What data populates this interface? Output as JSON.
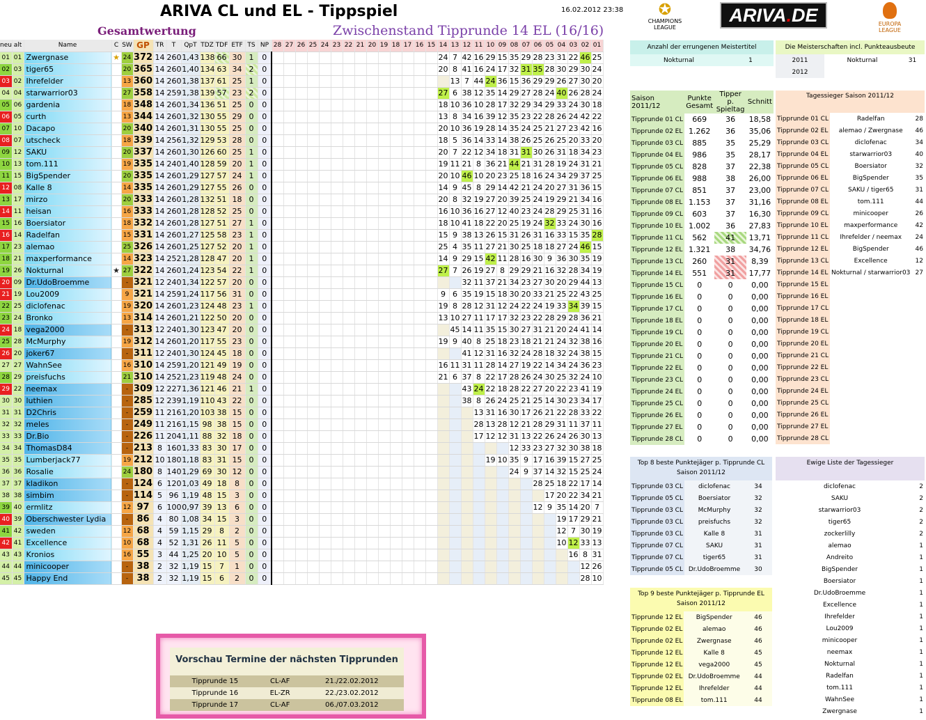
{
  "title": "ARIVA CL und EL - Tippspiel",
  "date": "16.02.2012 23:38",
  "logo_cl": "CHAMPIONS LEAGUE",
  "logo_ariva": "ARIVA.DE",
  "logo_el": "EUROPA LEAGUE",
  "gesamt": "Gesamtwertung",
  "zwischen": "Zwischenstand Tipprunde 14 EL (16/16)",
  "cols": [
    "neu",
    "alt",
    "Name",
    "C",
    "SW",
    "GP",
    "TR",
    "T",
    "QpT",
    "TDZ",
    "TDF",
    "ETF",
    "TS",
    "NP"
  ],
  "round_cols": [
    "28",
    "27",
    "26",
    "25",
    "24",
    "23",
    "22",
    "21",
    "20",
    "19",
    "18",
    "17",
    "16",
    "15",
    "14",
    "13",
    "12",
    "11",
    "10",
    "09",
    "08",
    "07",
    "06",
    "05",
    "04",
    "03",
    "02",
    "01"
  ],
  "rows": [
    [
      "01",
      "01",
      "Zwergnase",
      "★",
      "24",
      "372",
      "14",
      "260",
      "1,43",
      "138",
      "66",
      "30",
      "1",
      "0",
      "24 7 42 16 29 15 35 29 28 23 31 22 46 25"
    ],
    [
      "02",
      "03",
      "tiger65",
      "",
      "20",
      "365",
      "14",
      "260",
      "1,40",
      "134",
      "63",
      "34",
      "2",
      "0",
      "20 8 41 16 24 17 32 31 35 28 30 29 30 24"
    ],
    [
      "03",
      "02",
      "Ihrefelder",
      "",
      "13",
      "360",
      "14",
      "260",
      "1,38",
      "137",
      "61",
      "25",
      "1",
      "0",
      "13 7 44 24 36 15 36 29 29 26 27 30 20"
    ],
    [
      "04",
      "04",
      "starwarrior03",
      "",
      "27",
      "358",
      "14",
      "259",
      "1,38",
      "139",
      "57",
      "23",
      "2",
      "0",
      "27 6 38 12 35 14 29 27 28 24 40 26 28 24"
    ],
    [
      "05",
      "06",
      "gardenia",
      "",
      "18",
      "348",
      "14",
      "260",
      "1,34",
      "136",
      "51",
      "25",
      "0",
      "0",
      "18 10 36 10 28 17 32 29 34 29 33 24 30 18"
    ],
    [
      "06",
      "05",
      "curth",
      "",
      "13",
      "344",
      "14",
      "260",
      "1,32",
      "130",
      "55",
      "29",
      "0",
      "0",
      "13 8 34 16 39 12 35 23 22 28 26 24 42 22"
    ],
    [
      "07",
      "10",
      "Dacapo",
      "",
      "20",
      "340",
      "14",
      "260",
      "1,31",
      "130",
      "55",
      "25",
      "0",
      "0",
      "20 10 36 19 28 14 35 24 25 21 27 23 42 16"
    ],
    [
      "08",
      "07",
      "utscheck",
      "",
      "18",
      "339",
      "14",
      "256",
      "1,32",
      "129",
      "53",
      "28",
      "0",
      "0",
      "18 5 36 14 33 14 38 26 25 26 25 20 33 20"
    ],
    [
      "09",
      "12",
      "SAKU",
      "",
      "20",
      "337",
      "14",
      "260",
      "1,30",
      "126",
      "60",
      "25",
      "1",
      "0",
      "20 7 22 12 34 18 31 31 30 26 31 18 34 23"
    ],
    [
      "10",
      "13",
      "tom.111",
      "",
      "19",
      "335",
      "14",
      "240",
      "1,40",
      "128",
      "59",
      "20",
      "1",
      "0",
      "19 11 21 8 36 21 44 21 31 28 19 24 31 21"
    ],
    [
      "11",
      "15",
      "BigSpender",
      "",
      "20",
      "335",
      "14",
      "260",
      "1,29",
      "127",
      "57",
      "24",
      "1",
      "0",
      "20 10 46 10 20 23 25 18 16 24 34 29 37 25"
    ],
    [
      "12",
      "08",
      "Kalle 8",
      "",
      "14",
      "335",
      "14",
      "260",
      "1,29",
      "127",
      "55",
      "26",
      "0",
      "0",
      "14 9 45 8 29 14 42 21 24 20 27 31 36 15"
    ],
    [
      "13",
      "17",
      "mirzo",
      "",
      "20",
      "333",
      "14",
      "260",
      "1,28",
      "132",
      "51",
      "18",
      "0",
      "0",
      "20 8 32 19 27 20 39 25 24 19 29 21 34 16"
    ],
    [
      "14",
      "11",
      "heisan",
      "",
      "16",
      "333",
      "14",
      "260",
      "1,28",
      "128",
      "52",
      "25",
      "0",
      "0",
      "16 10 36 16 27 12 40 23 24 28 29 25 31 16"
    ],
    [
      "15",
      "16",
      "Boersiator",
      "",
      "18",
      "332",
      "14",
      "260",
      "1,28",
      "127",
      "51",
      "27",
      "1",
      "0",
      "18 10 41 18 22 20 25 19 24 32 33 24 30 16"
    ],
    [
      "16",
      "14",
      "Radelfan",
      "",
      "15",
      "331",
      "14",
      "260",
      "1,27",
      "125",
      "58",
      "23",
      "1",
      "0",
      "15 9 38 13 26 15 31 26 31 16 33 15 35 28"
    ],
    [
      "17",
      "23",
      "alemao",
      "",
      "25",
      "326",
      "14",
      "260",
      "1,25",
      "127",
      "52",
      "20",
      "1",
      "0",
      "25 4 35 11 27 21 30 25 18 18 27 24 46 15"
    ],
    [
      "18",
      "21",
      "maxperformance",
      "",
      "14",
      "323",
      "14",
      "252",
      "1,28",
      "128",
      "47",
      "20",
      "1",
      "0",
      "14 9 29 15 42 11 28 16 30 9 36 30 35 19"
    ],
    [
      "19",
      "26",
      "Nokturnal",
      "★",
      "27",
      "322",
      "14",
      "260",
      "1,24",
      "123",
      "54",
      "22",
      "1",
      "0",
      "27 7 26 19 27 8 29 29 21 16 32 28 34 19"
    ],
    [
      "20",
      "09",
      "Dr.UdoBroemme",
      "",
      "-",
      "321",
      "12",
      "240",
      "1,34",
      "122",
      "57",
      "20",
      "0",
      "0",
      "32 11 37 21 34 23 27 30 20 29 44 13"
    ],
    [
      "21",
      "19",
      "Lou2009",
      "",
      "9",
      "321",
      "14",
      "259",
      "1,24",
      "117",
      "56",
      "31",
      "0",
      "0",
      "9 6 35 19 15 18 30 20 33 21 25 22 43 25"
    ],
    [
      "22",
      "25",
      "diclofenac",
      "",
      "19",
      "320",
      "14",
      "260",
      "1,23",
      "124",
      "48",
      "23",
      "1",
      "0",
      "19 8 28 12 31 12 24 22 24 19 33 34 39 15"
    ],
    [
      "23",
      "24",
      "Bronko",
      "",
      "13",
      "314",
      "14",
      "260",
      "1,21",
      "122",
      "50",
      "20",
      "0",
      "0",
      "13 10 27 11 17 17 32 23 22 28 29 28 36 21"
    ],
    [
      "24",
      "18",
      "vega2000",
      "",
      "-",
      "313",
      "12",
      "240",
      "1,30",
      "123",
      "47",
      "20",
      "0",
      "0",
      "45 14 11 35 15 30 27 31 21 20 24 41 14"
    ],
    [
      "25",
      "28",
      "McMurphy",
      "",
      "19",
      "312",
      "14",
      "260",
      "1,20",
      "117",
      "55",
      "23",
      "0",
      "0",
      "19 9 40 8 25 18 23 18 21 21 24 32 38 16"
    ],
    [
      "26",
      "20",
      "joker67",
      "",
      "-",
      "311",
      "12",
      "240",
      "1,30",
      "124",
      "45",
      "18",
      "0",
      "0",
      "41 12 31 16 32 24 28 18 32 24 38 15"
    ],
    [
      "27",
      "27",
      "WahnSee",
      "",
      "16",
      "310",
      "14",
      "259",
      "1,20",
      "121",
      "49",
      "19",
      "0",
      "0",
      "16 11 31 11 28 14 27 19 22 14 34 24 36 23"
    ],
    [
      "28",
      "29",
      "preisfuchs",
      "",
      "21",
      "310",
      "14",
      "252",
      "1,23",
      "119",
      "48",
      "24",
      "0",
      "0",
      "21 6 37 8 22 17 28 26 24 30 25 32 24 10"
    ],
    [
      "29",
      "22",
      "neemax",
      "",
      "-",
      "309",
      "12",
      "227",
      "1,36",
      "121",
      "46",
      "21",
      "1",
      "0",
      "43 24 22 18 28 22 27 20 22 23 41 19"
    ],
    [
      "30",
      "30",
      "luthien",
      "",
      "-",
      "285",
      "12",
      "239",
      "1,19",
      "110",
      "43",
      "22",
      "0",
      "0",
      "38 8 26 24 25 21 25 14 30 23 34 17"
    ],
    [
      "31",
      "31",
      "D2Chris",
      "",
      "-",
      "259",
      "11",
      "216",
      "1,20",
      "103",
      "38",
      "15",
      "0",
      "0",
      "13 31 16 30 17 26 21 22 28 33 22"
    ],
    [
      "32",
      "32",
      "meles",
      "",
      "-",
      "249",
      "11",
      "216",
      "1,15",
      "98",
      "38",
      "15",
      "0",
      "0",
      "28 13 28 12 21 28 29 31 11 37 11"
    ],
    [
      "33",
      "33",
      "Dr.Bio",
      "",
      "-",
      "226",
      "11",
      "204",
      "1,11",
      "88",
      "32",
      "18",
      "0",
      "0",
      "17 12 12 31 13 22 26 24 26 30 13"
    ],
    [
      "34",
      "34",
      "ThomasD84",
      "",
      "-",
      "213",
      "8",
      "160",
      "1,33",
      "83",
      "30",
      "17",
      "0",
      "0",
      "12 33 23 27 32 30 38 18"
    ],
    [
      "35",
      "35",
      "Lumberjack77",
      "",
      "19",
      "212",
      "10",
      "180",
      "1,18",
      "83",
      "31",
      "15",
      "0",
      "0",
      "19 10 35 9 17 16 39 15 27 25"
    ],
    [
      "36",
      "36",
      "Rosalie",
      "",
      "24",
      "180",
      "8",
      "140",
      "1,29",
      "69",
      "30",
      "12",
      "0",
      "0",
      "24 9 37 14 32 15 25 24"
    ],
    [
      "37",
      "37",
      "kladikon",
      "",
      "-",
      "124",
      "6",
      "120",
      "1,03",
      "49",
      "18",
      "8",
      "0",
      "0",
      "28 25 18 22 17 14"
    ],
    [
      "38",
      "38",
      "simbim",
      "",
      "-",
      "114",
      "5",
      "96",
      "1,19",
      "48",
      "15",
      "3",
      "0",
      "0",
      "17 20 22 34 21"
    ],
    [
      "39",
      "40",
      "ermlitz",
      "",
      "12",
      "97",
      "6",
      "100",
      "0,97",
      "39",
      "13",
      "6",
      "0",
      "0",
      "12 9 35 14 20 7"
    ],
    [
      "40",
      "39",
      "Oberschwester Lydia",
      "",
      "-",
      "86",
      "4",
      "80",
      "1,08",
      "34",
      "15",
      "3",
      "0",
      "0",
      "19 17 29 21"
    ],
    [
      "41",
      "42",
      "sweden",
      "",
      "12",
      "68",
      "4",
      "59",
      "1,15",
      "29",
      "8",
      "2",
      "0",
      "0",
      "12 7 30 19"
    ],
    [
      "42",
      "41",
      "Excellence",
      "",
      "10",
      "68",
      "4",
      "52",
      "1,31",
      "26",
      "11",
      "5",
      "0",
      "0",
      "10 12 33 13"
    ],
    [
      "43",
      "43",
      "Kronios",
      "",
      "16",
      "55",
      "3",
      "44",
      "1,25",
      "20",
      "10",
      "5",
      "0",
      "0",
      "16 8 31"
    ],
    [
      "44",
      "44",
      "minicooper",
      "",
      "-",
      "38",
      "2",
      "32",
      "1,19",
      "15",
      "7",
      "1",
      "0",
      "0",
      "12 26"
    ],
    [
      "45",
      "45",
      "Happy End",
      "",
      "-",
      "38",
      "2",
      "32",
      "1,19",
      "15",
      "6",
      "2",
      "0",
      "0",
      "28 10"
    ]
  ],
  "meister": {
    "title": "Anzahl der errungenen Meistertitel",
    "name": "Nokturnal",
    "count": "1"
  },
  "meister_punkte": {
    "title": "Die Meisterschaften incl. Punkteausbeute",
    "rows": [
      [
        "2011",
        "Nokturnal",
        "31"
      ],
      [
        "2012",
        "",
        ""
      ]
    ]
  },
  "saison": {
    "h1": "Saison 2011/12",
    "h2": "Punkte Gesamt",
    "h3": "Tipper p. Spieltag",
    "h4": "Schnitt",
    "rows": [
      [
        "Tipprunde 01 CL",
        "669",
        "36",
        "18,58"
      ],
      [
        "Tipprunde 02 EL",
        "1.262",
        "36",
        "35,06"
      ],
      [
        "Tipprunde 03 CL",
        "885",
        "35",
        "25,29"
      ],
      [
        "Tipprunde 04 EL",
        "986",
        "35",
        "28,17"
      ],
      [
        "Tipprunde 05 CL",
        "828",
        "37",
        "22,38"
      ],
      [
        "Tipprunde 06 EL",
        "988",
        "38",
        "26,00"
      ],
      [
        "Tipprunde 07 CL",
        "851",
        "37",
        "23,00"
      ],
      [
        "Tipprunde 08 EL",
        "1.153",
        "37",
        "31,16"
      ],
      [
        "Tipprunde 09 CL",
        "603",
        "37",
        "16,30"
      ],
      [
        "Tipprunde 10 EL",
        "1.002",
        "36",
        "27,83"
      ],
      [
        "Tipprunde 11 CL",
        "562",
        "41",
        "13,71"
      ],
      [
        "Tipprunde 12 EL",
        "1.321",
        "38",
        "34,76"
      ],
      [
        "Tipprunde 13 CL",
        "260",
        "31",
        "8,39"
      ],
      [
        "Tipprunde 14 EL",
        "551",
        "31",
        "17,77"
      ],
      [
        "Tipprunde 15 CL",
        "0",
        "0",
        "0,00"
      ],
      [
        "Tipprunde 16 EL",
        "0",
        "0",
        "0,00"
      ],
      [
        "Tipprunde 17 CL",
        "0",
        "0",
        "0,00"
      ],
      [
        "Tipprunde 18 EL",
        "0",
        "0",
        "0,00"
      ],
      [
        "Tipprunde 19 CL",
        "0",
        "0",
        "0,00"
      ],
      [
        "Tipprunde 20 EL",
        "0",
        "0",
        "0,00"
      ],
      [
        "Tipprunde 21 CL",
        "0",
        "0",
        "0,00"
      ],
      [
        "Tipprunde 22 EL",
        "0",
        "0",
        "0,00"
      ],
      [
        "Tipprunde 23 CL",
        "0",
        "0",
        "0,00"
      ],
      [
        "Tipprunde 24 EL",
        "0",
        "0",
        "0,00"
      ],
      [
        "Tipprunde 25 CL",
        "0",
        "0",
        "0,00"
      ],
      [
        "Tipprunde 26 EL",
        "0",
        "0",
        "0,00"
      ],
      [
        "Tipprunde 27 EL",
        "0",
        "0",
        "0,00"
      ],
      [
        "Tipprunde 28 CL",
        "0",
        "0",
        "0,00"
      ]
    ]
  },
  "tagessieger": {
    "title": "Tagessieger Saison 2011/12",
    "rows": [
      [
        "Tipprunde 01 CL",
        "Radelfan",
        "28"
      ],
      [
        "Tipprunde 02 EL",
        "alemao / Zwergnase",
        "46"
      ],
      [
        "Tipprunde 03 CL",
        "diclofenac",
        "34"
      ],
      [
        "Tipprunde 04 EL",
        "starwarrior03",
        "40"
      ],
      [
        "Tipprunde 05 CL",
        "Boersiator",
        "32"
      ],
      [
        "Tipprunde 06 EL",
        "BigSpender",
        "35"
      ],
      [
        "Tipprunde 07 CL",
        "SAKU / tiger65",
        "31"
      ],
      [
        "Tipprunde 08 EL",
        "tom.111",
        "44"
      ],
      [
        "Tipprunde 09 CL",
        "minicooper",
        "26"
      ],
      [
        "Tipprunde 10 EL",
        "maxperformance",
        "42"
      ],
      [
        "Tipprunde 11 CL",
        "Ihrefelder / neemax",
        "24"
      ],
      [
        "Tipprunde 12 EL",
        "BigSpender",
        "46"
      ],
      [
        "Tipprunde 13 CL",
        "Excellence",
        "12"
      ],
      [
        "Tipprunde 14 EL",
        "Nokturnal / starwarrior03",
        "27"
      ],
      [
        "Tipprunde 15 EL",
        "",
        ""
      ],
      [
        "Tipprunde 16 EL",
        "",
        ""
      ],
      [
        "Tipprunde 17 CL",
        "",
        ""
      ],
      [
        "Tipprunde 18 EL",
        "",
        ""
      ],
      [
        "Tipprunde 19 CL",
        "",
        ""
      ],
      [
        "Tipprunde 20 EL",
        "",
        ""
      ],
      [
        "Tipprunde 21 CL",
        "",
        ""
      ],
      [
        "Tipprunde 22 EL",
        "",
        ""
      ],
      [
        "Tipprunde 23 CL",
        "",
        ""
      ],
      [
        "Tipprunde 24 EL",
        "",
        ""
      ],
      [
        "Tipprunde 25 CL",
        "",
        ""
      ],
      [
        "Tipprunde 26 EL",
        "",
        ""
      ],
      [
        "Tipprunde 27 EL",
        "",
        ""
      ],
      [
        "Tipprunde 28 CL",
        "",
        ""
      ]
    ]
  },
  "top8": {
    "title": "Top 8 beste Punktejäger p. Tipprunde CL Saison 2011/12",
    "rows": [
      [
        "Tipprunde 03 CL",
        "diclofenac",
        "34"
      ],
      [
        "Tipprunde 05 CL",
        "Boersiator",
        "32"
      ],
      [
        "Tipprunde 03 CL",
        "McMurphy",
        "32"
      ],
      [
        "Tipprunde 03 CL",
        "preisfuchs",
        "32"
      ],
      [
        "Tipprunde 03 CL",
        "Kalle 8",
        "31"
      ],
      [
        "Tipprunde 07 CL",
        "SAKU",
        "31"
      ],
      [
        "Tipprunde 07 CL",
        "tiger65",
        "31"
      ],
      [
        "Tipprunde 05 CL",
        "Dr.UdoBroemme",
        "30"
      ]
    ]
  },
  "top9": {
    "title": "Top 9 beste Punktejäger p. Tipprunde EL Saison 2011/12",
    "rows": [
      [
        "Tipprunde 12 EL",
        "BigSpender",
        "46"
      ],
      [
        "Tipprunde 02 EL",
        "alemao",
        "46"
      ],
      [
        "Tipprunde 02 EL",
        "Zwergnase",
        "46"
      ],
      [
        "Tipprunde 12 EL",
        "Kalle 8",
        "45"
      ],
      [
        "Tipprunde 12 EL",
        "vega2000",
        "45"
      ],
      [
        "Tipprunde 02 EL",
        "Dr.UdoBroemme",
        "44"
      ],
      [
        "Tipprunde 12 EL",
        "Ihrefelder",
        "44"
      ],
      [
        "Tipprunde 08 EL",
        "tom.111",
        "44"
      ]
    ]
  },
  "ewige": {
    "title": "Ewige Liste der Tagessieger",
    "rows": [
      [
        "diclofenac",
        "2"
      ],
      [
        "SAKU",
        "2"
      ],
      [
        "starwarrior03",
        "2"
      ],
      [
        "tiger65",
        "2"
      ],
      [
        "zockerlilly",
        "2"
      ],
      [
        "alemao",
        "1"
      ],
      [
        "Andreito",
        "1"
      ],
      [
        "BigSpender",
        "1"
      ],
      [
        "Boersiator",
        "1"
      ],
      [
        "Dr.UdoBroemme",
        "1"
      ],
      [
        "Excellence",
        "1"
      ],
      [
        "Ihrefelder",
        "1"
      ],
      [
        "Lou2009",
        "1"
      ],
      [
        "minicooper",
        "1"
      ],
      [
        "neemax",
        "1"
      ],
      [
        "Nokturnal",
        "1"
      ],
      [
        "Radelfan",
        "1"
      ],
      [
        "tom.111",
        "1"
      ],
      [
        "WahnSee",
        "1"
      ],
      [
        "Zwergnase",
        "1"
      ]
    ]
  },
  "preview": {
    "title": "Vorschau Termine der nächsten Tipprunden",
    "rows": [
      [
        "Tipprunde 15",
        "CL-AF",
        "21./22.02.2012"
      ],
      [
        "Tipprunde 16",
        "EL-ZR",
        "22./23.02.2012"
      ],
      [
        "Tipprunde 17",
        "CL-AF",
        "06./07.03.2012"
      ]
    ]
  }
}
